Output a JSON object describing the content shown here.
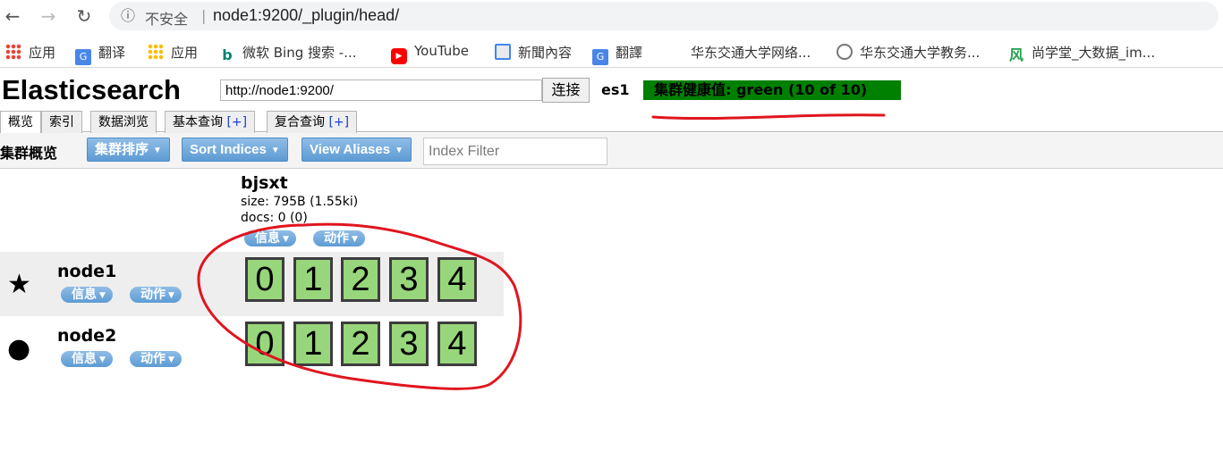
{
  "browser": {
    "security_label": "不安全",
    "url": "node1:9200/_plugin/head/",
    "bookmarks": [
      {
        "label": "应用",
        "icon": "apps-grid-icon"
      },
      {
        "label": "翻译",
        "icon": "google-translate-icon"
      },
      {
        "label": "应用",
        "icon": "apps-grid-icon"
      },
      {
        "label": "微软 Bing 搜索 -...",
        "icon": "bing-icon"
      },
      {
        "label": "YouTube",
        "icon": "youtube-icon"
      },
      {
        "label": "新聞內容",
        "icon": "news-icon"
      },
      {
        "label": "翻譯",
        "icon": "google-translate-icon"
      },
      {
        "label": "华东交通大学网络...",
        "icon": "blank-page-icon"
      },
      {
        "label": "华东交通大学教务...",
        "icon": "university-seal-icon"
      },
      {
        "label": "尚学堂_大数据_im...",
        "icon": "wind-icon"
      }
    ]
  },
  "header": {
    "title": "Elasticsearch",
    "connect_url": "http://node1:9200/",
    "connect_label": "连接",
    "cluster_name": "es1",
    "health_text": "集群健康值: green (10 of 10)",
    "health_color": "#008000"
  },
  "tabs": [
    {
      "label": "概览",
      "active": true
    },
    {
      "label": "索引"
    },
    {
      "label": "数据浏览"
    },
    {
      "label": "基本查询",
      "suffix": "[+]"
    },
    {
      "label": "复合查询",
      "suffix": "[+]"
    }
  ],
  "overview": {
    "title": "集群概览",
    "sort_cluster_label": "集群排序",
    "sort_indices_label": "Sort Indices",
    "view_aliases_label": "View Aliases",
    "filter_placeholder": "Index Filter"
  },
  "index": {
    "name": "bjsxt",
    "size": "size: 795B (1.55ki)",
    "docs": "docs: 0 (0)",
    "info_label": "信息",
    "action_label": "动作"
  },
  "nodes": [
    {
      "name": "node1",
      "icon": "star-icon",
      "master": true,
      "info_label": "信息",
      "action_label": "动作",
      "shards": [
        "0",
        "1",
        "2",
        "3",
        "4"
      ]
    },
    {
      "name": "node2",
      "icon": "circle-icon",
      "master": false,
      "info_label": "信息",
      "action_label": "动作",
      "shards": [
        "0",
        "1",
        "2",
        "3",
        "4"
      ]
    }
  ],
  "colors": {
    "shard_green": "#98d67c",
    "button_blue": "#5d9bd3",
    "annotation_red": "#e0151e"
  }
}
